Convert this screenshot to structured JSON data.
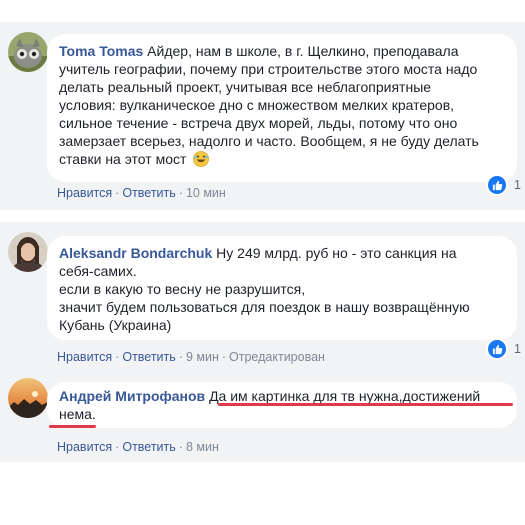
{
  "comments": [
    {
      "author": "Toma Tomas",
      "text_lines": [
        "Айдер, нам в школе, в г. Щелкино, преподавала",
        "учитель географии, почему при строительстве этого моста надо",
        "делать реальный проект, учитывая все неблагоприятные",
        "условия: вулканическое дно с множеством мелких кратеров,",
        "сильное течение - встреча двух морей, льды, потому что оно",
        "замерзает всерьез, надолго и часто. Вообщем, я не буду делать",
        "ставки на этот мост"
      ],
      "emoji": "laughing-face",
      "like_label": "Нравится",
      "reply_label": "Ответить",
      "time": "10 мин",
      "reaction_count": "1"
    },
    {
      "author": "Aleksandr Bondarchuk",
      "text_lines": [
        "Ну 249 млрд. руб но - это санкция на",
        "себя-самих.",
        "если в какую то весну не разрушится,",
        "значит будем пользоваться для поездок в нашу возвращённую",
        "Кубань (Украина)"
      ],
      "like_label": "Нравится",
      "reply_label": "Ответить",
      "time": "9 мин",
      "edited_label": "Отредактирован",
      "reaction_count": "1"
    },
    {
      "author": "Андрей Митрофанов",
      "text_lines": [
        "Да им картинка для тв нужна,достижений",
        "нема."
      ],
      "like_label": "Нравится",
      "reply_label": "Ответить",
      "time": "8 мин"
    }
  ],
  "colors": {
    "background": "#f2f3f5",
    "author": "#385898",
    "like_badge": "#1877f2",
    "underline": "#e0394a"
  },
  "icons": [
    "like-thumb-icon",
    "laughing-emoji-icon",
    "avatar-photo"
  ]
}
